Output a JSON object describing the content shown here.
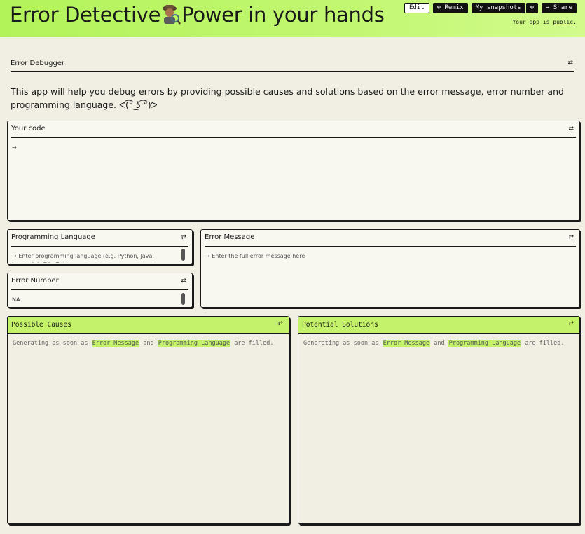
{
  "header": {
    "title_part1": "Error Detective",
    "title_part2": "Power in your hands",
    "buttons": {
      "edit": "Edit",
      "remix": "⊚ Remix",
      "snapshots": "My snapshots",
      "snapshot_icon": "⊚",
      "share": "→ Share"
    },
    "public_prefix": "Your app is ",
    "public_link": "public",
    "public_suffix": "."
  },
  "section": {
    "title": "Error Debugger",
    "intro": "This app will help you debug errors by providing possible causes and solutions based on the error message, error number and programming language. ᕙ(͡° ͜ʖ ͡°)ᕗ"
  },
  "inputs": {
    "code": {
      "label": "Your code",
      "placeholder": "→"
    },
    "language": {
      "label": "Programming Language",
      "placeholder": "→  Enter programming language (e.g. Python, Java, Javascript, C#, Go)"
    },
    "error_number": {
      "label": "Error Number",
      "value": "NA"
    },
    "error_message": {
      "label": "Error Message",
      "placeholder": "→  Enter the full error message here"
    }
  },
  "outputs": {
    "causes": {
      "title": "Possible Causes"
    },
    "solutions": {
      "title": "Potential Solutions"
    },
    "status_prefix": "Generating as soon as ",
    "status_field1": "Error Message",
    "status_and": " and ",
    "status_field2": "Programming Language",
    "status_suffix": " are filled."
  },
  "icons": {
    "tune": "tune-icon",
    "detective": "detective-emoji-icon"
  }
}
